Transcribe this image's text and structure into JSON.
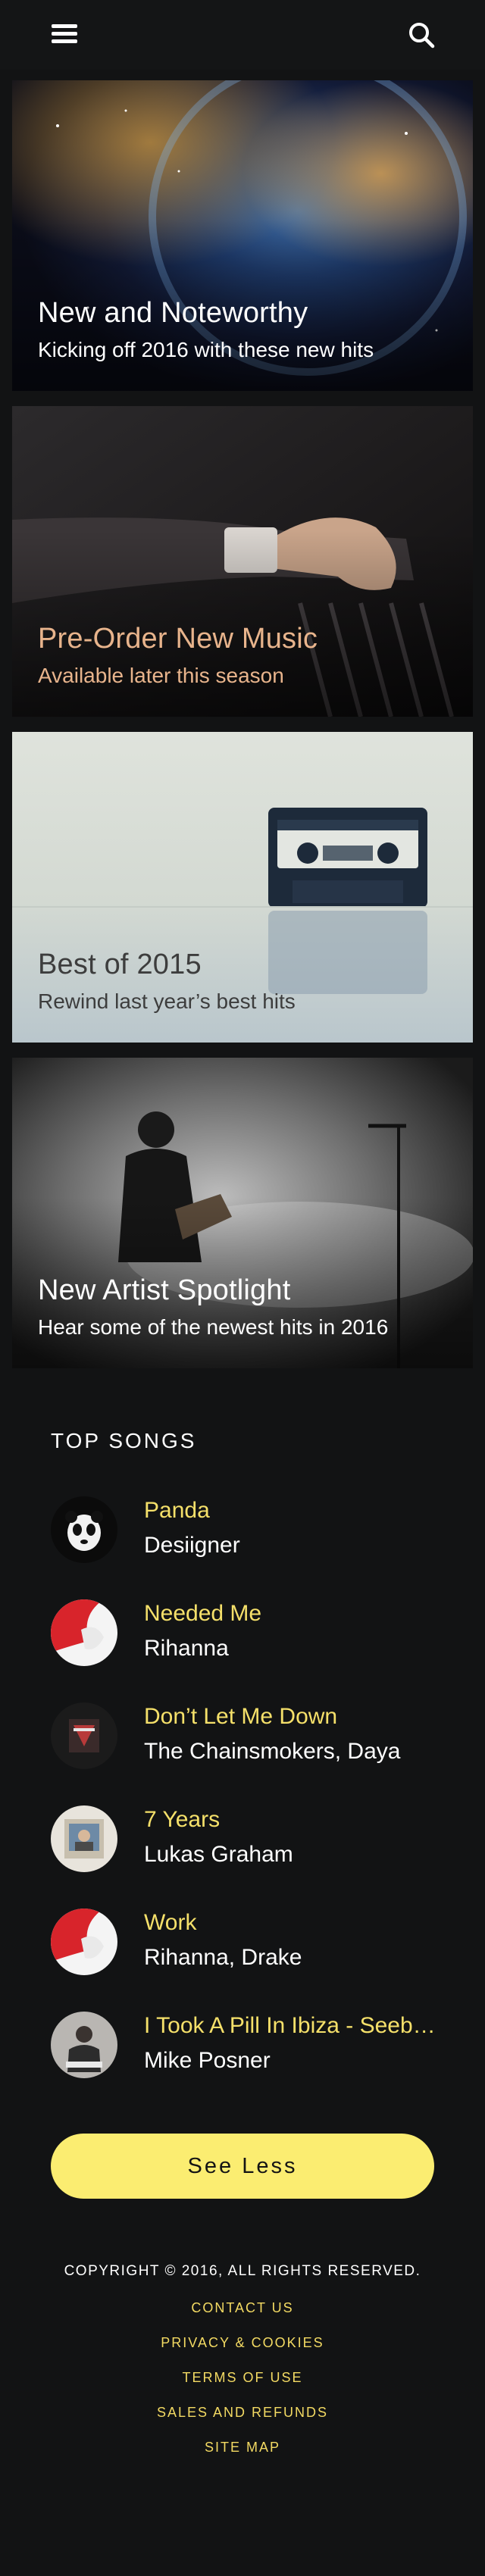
{
  "header": {
    "menu_icon": "hamburger-menu-icon",
    "search_icon": "search-icon"
  },
  "cards": [
    {
      "title": "New and Noteworthy",
      "subtitle": "Kicking off 2016 with these new hits",
      "title_color": "#ffffff",
      "subtitle_color": "#ffffff"
    },
    {
      "title": "Pre-Order New Music",
      "subtitle": "Available later this season",
      "title_color": "#e8b48c",
      "subtitle_color": "#e8b48c"
    },
    {
      "title": "Best of 2015",
      "subtitle": "Rewind last year’s best hits",
      "title_color": "#3d3d3d",
      "subtitle_color": "#3d3d3d"
    },
    {
      "title": "New Artist Spotlight",
      "subtitle": "Hear some of the newest hits in 2016",
      "title_color": "#ffffff",
      "subtitle_color": "#ffffff"
    }
  ],
  "top_songs": {
    "heading": "TOP SONGS",
    "songs": [
      {
        "title": "Panda",
        "artist": "Desiigner"
      },
      {
        "title": "Needed Me",
        "artist": "Rihanna"
      },
      {
        "title": "Don’t Let Me Down",
        "artist": "The Chainsmokers, Daya"
      },
      {
        "title": "7 Years",
        "artist": "Lukas Graham"
      },
      {
        "title": "Work",
        "artist": "Rihanna, Drake"
      },
      {
        "title": "I Took A Pill In Ibiza - Seeb…",
        "artist": "Mike Posner"
      }
    ],
    "see_less_label": "See Less"
  },
  "footer": {
    "copyright": "COPYRIGHT © 2016, ALL RIGHTS RESERVED.",
    "links": [
      "CONTACT US",
      "PRIVACY & COOKIES",
      "TERMS OF USE",
      "SALES AND REFUNDS",
      "SITE MAP"
    ]
  },
  "colors": {
    "background": "#121314",
    "accent_yellow": "#fbed71",
    "song_title": "#f5e06a"
  }
}
